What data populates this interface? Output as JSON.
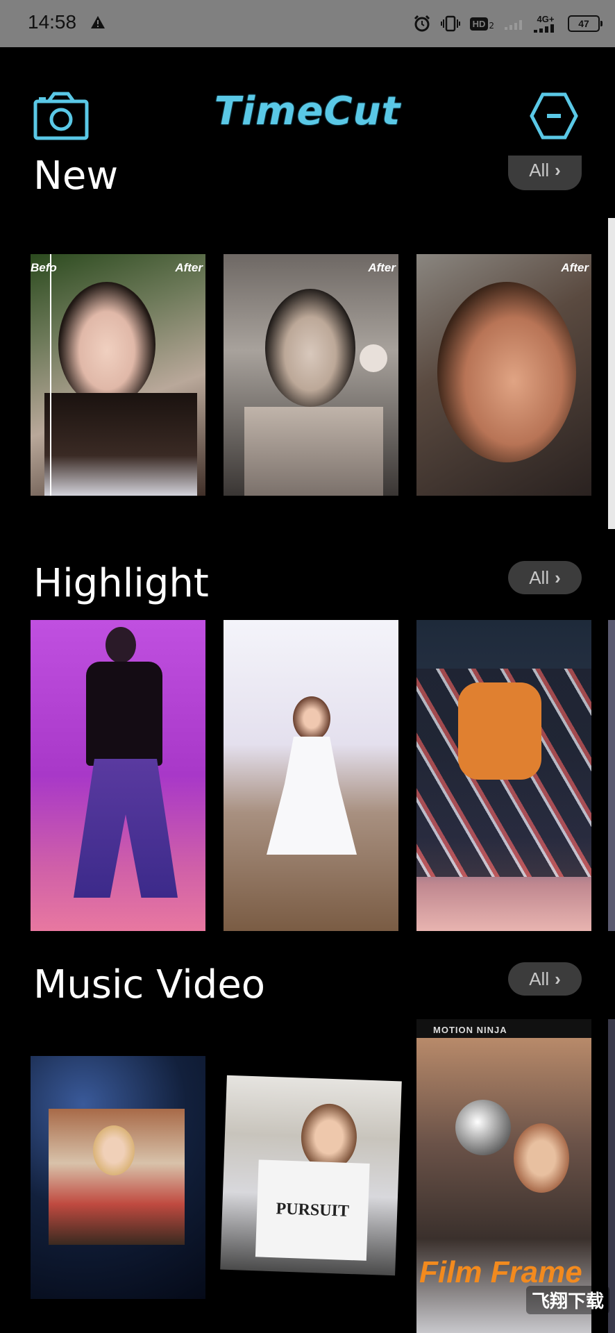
{
  "status_bar": {
    "time": "14:58",
    "network": "4G+",
    "hd": "HD",
    "hd_sub": "2",
    "battery": "47"
  },
  "header": {
    "logo_text": "TimeCut",
    "camera_icon": "camera-icon",
    "settings_icon": "hexagon-settings-icon",
    "accent_color": "#5ac8e6"
  },
  "sections": {
    "new": {
      "title": "New",
      "all_label": "All",
      "items": [
        {
          "before_label": "Befo",
          "after_label": "After"
        },
        {
          "after_label": "After"
        },
        {
          "after_label": "After"
        }
      ]
    },
    "highlight": {
      "title": "Highlight",
      "all_label": "All"
    },
    "music_video": {
      "title": "Music Video",
      "all_label": "All",
      "items": [
        {
          "caption": ""
        },
        {
          "shirt_text": "PURSUIT"
        },
        {
          "top_label": "MOTION NINJA",
          "overlay_text": "Film Frame"
        }
      ]
    }
  },
  "watermark": "飞翔下载"
}
